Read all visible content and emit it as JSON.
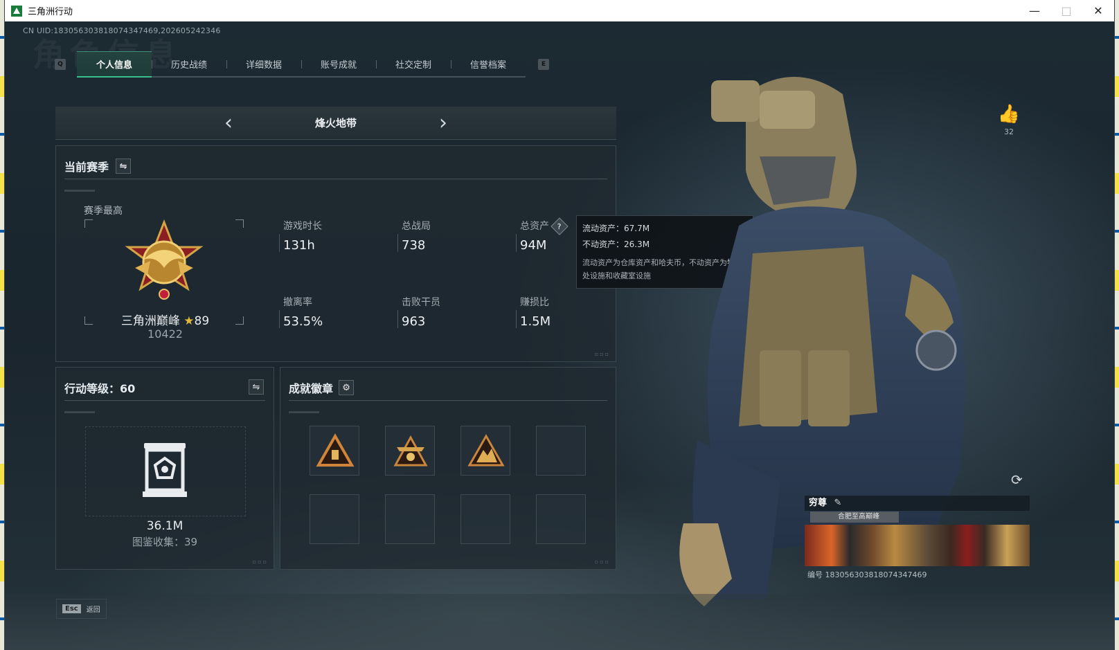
{
  "window": {
    "title": "三角洲行动",
    "buttons": {
      "minimize": "—",
      "maximize": "□",
      "close": "✕"
    }
  },
  "uid": "CN UID:18305630381807434746​9,202605242346",
  "tabs": {
    "left_key": "Q",
    "right_key": "E",
    "items": [
      {
        "label": "个人信息",
        "active": true
      },
      {
        "label": "历史战绩"
      },
      {
        "label": "详细数据"
      },
      {
        "label": "账号成就"
      },
      {
        "label": "社交定制"
      },
      {
        "label": "信誉档案"
      }
    ]
  },
  "mode": {
    "title": "烽火地带",
    "prev": "‹",
    "next": "›"
  },
  "season": {
    "title": "当前赛季",
    "best_label": "赛季最高",
    "rank_name": "三角洲巅峰",
    "rank_star": "★",
    "rank_level": "89",
    "rank_score": "10422",
    "stats": [
      {
        "label": "游戏时长",
        "value": "131h"
      },
      {
        "label": "总战局",
        "value": "738"
      },
      {
        "label": "总资产",
        "value": "94M"
      },
      {
        "label": "撤离率",
        "value": "53.5%"
      },
      {
        "label": "击败干员",
        "value": "963"
      },
      {
        "label": "赚损比",
        "value": "1.5M"
      }
    ],
    "help": "?"
  },
  "tooltip": {
    "liquid": "流动资产：67.7M",
    "fixed": "不动资产：26.3M",
    "desc": "流动资产为仓库资产和哈夫币，不动资产为特勤处设施和收藏室设施"
  },
  "level": {
    "title": "行动等级：60",
    "value": "36.1M",
    "collect": "图鉴收集：39"
  },
  "badges": {
    "title": "成就徽章",
    "filled": 3,
    "total": 8
  },
  "profile": {
    "likes": "32",
    "name": "穷尊",
    "edit": "✎",
    "sub": "合肥至高巅峰",
    "id": "编号 183056303818074347469"
  },
  "esc": {
    "key": "Esc",
    "label": "返回"
  },
  "colors": {
    "accent": "#35c08e",
    "gold": "#e2b83e"
  }
}
